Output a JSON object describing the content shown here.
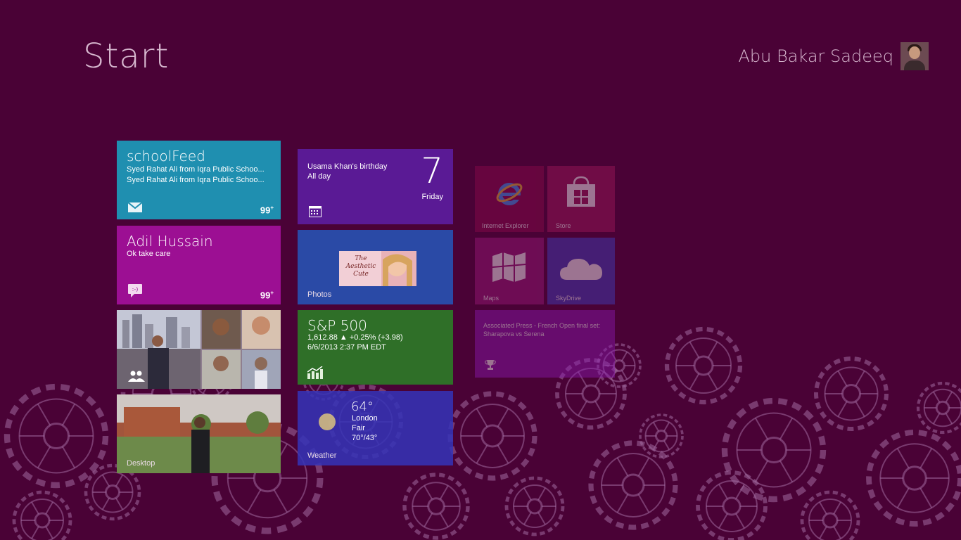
{
  "screen": {
    "title": "Start"
  },
  "user": {
    "name": "Abu Bakar Sadeeq"
  },
  "tiles": {
    "mail": {
      "heading": "schoolFeed",
      "line1": "Syed Rahat Ali from Iqra Public Schoo...",
      "line2": "Syed Rahat Ali from Iqra Public Schoo...",
      "badge": "99",
      "badge_sup": "+",
      "icon": "mail-icon",
      "color": "#1f8fb0"
    },
    "messaging": {
      "heading": "Adil Hussain",
      "line1": "Ok take care",
      "badge": "99",
      "badge_sup": "+",
      "icon": "messaging-icon",
      "color": "#9c0f93"
    },
    "people": {
      "icon": "people-icon"
    },
    "desktop": {
      "label": "Desktop"
    },
    "calendar": {
      "event": "Usama Khan's birthday",
      "time": "All day",
      "day_number": "7",
      "day_name": "Friday",
      "icon": "calendar-icon",
      "color": "#5a1a95"
    },
    "photos": {
      "label": "Photos",
      "caption": "The Aesthetic Cute",
      "color": "#2a4aa6"
    },
    "finance": {
      "heading": "S&P 500",
      "quote": "1,612.88  ▲ +0.25% (+3.98)",
      "timestamp": "6/6/2013 2:37 PM EDT",
      "icon": "finance-chart-icon",
      "color": "#2f6f28"
    },
    "weather": {
      "label": "Weather",
      "temp": "64°",
      "city": "London",
      "condition": "Fair",
      "range": "70°/43°",
      "color": "#3434b8"
    },
    "ie": {
      "label": "Internet Explorer",
      "icon": "internet-explorer-icon"
    },
    "store": {
      "label": "Store",
      "icon": "store-bag-icon"
    },
    "maps": {
      "label": "Maps",
      "icon": "map-icon"
    },
    "skydrive": {
      "label": "SkyDrive",
      "icon": "cloud-icon"
    },
    "sports": {
      "headline": "Associated Press - French Open final set: Sharapova vs Serena",
      "icon": "trophy-icon"
    }
  },
  "colors": {
    "background": "#4a0236",
    "gears": "#a06a9e"
  }
}
